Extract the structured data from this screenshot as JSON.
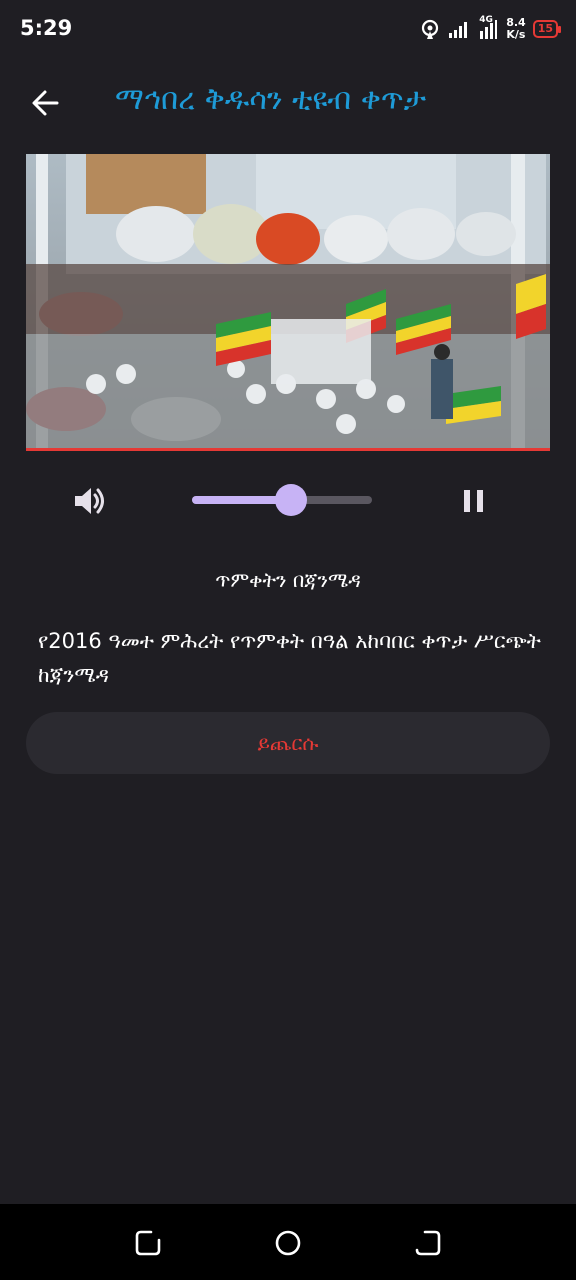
{
  "status_bar": {
    "time": "5:29",
    "network_type": "4G",
    "net_speed_value": "8.4",
    "net_speed_unit": "K/s",
    "battery_level": "15"
  },
  "app_bar": {
    "title": "ማኅበረ ቅዱሳን ቲዩብ ቀጥታ",
    "back_icon": "arrow-left-icon"
  },
  "player": {
    "volume_icon": "volume-icon",
    "volume_level": 0.55,
    "pause_icon": "pause-icon",
    "progress_color": "#e53935"
  },
  "content": {
    "track_title": "ጥምቀትን በጃንሜዳ",
    "description": "የ2016 ዓመተ ምሕረት የጥምቀት በዓል አከባበር ቀጥታ ሥርጭት ከጃንሜዳ",
    "close_button": "ይጨርሱ"
  },
  "colors": {
    "background": "#1f1e23",
    "title_accent": "#1e9bd7",
    "slider_accent": "#c7b3f5",
    "danger": "#e53935"
  },
  "nav_bar": {
    "icons": [
      "recents-icon",
      "home-icon",
      "back-icon"
    ]
  }
}
